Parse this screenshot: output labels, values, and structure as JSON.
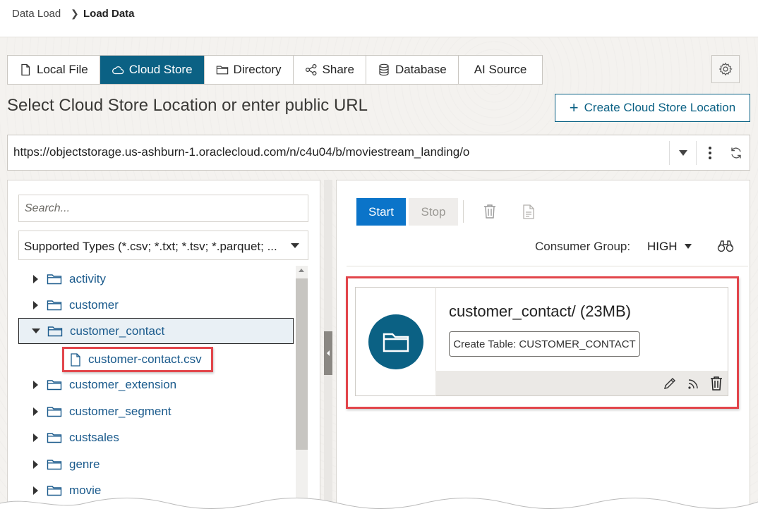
{
  "breadcrumb": {
    "parent": "Data Load",
    "current": "Load Data"
  },
  "tabs": [
    {
      "label": "Local File",
      "icon": "file-icon",
      "active": false
    },
    {
      "label": "Cloud Store",
      "icon": "cloud-icon",
      "active": true
    },
    {
      "label": "Directory",
      "icon": "folder-icon",
      "active": false
    },
    {
      "label": "Share",
      "icon": "share-icon",
      "active": false
    },
    {
      "label": "Database",
      "icon": "database-icon",
      "active": false
    },
    {
      "label": "AI Source",
      "icon": "",
      "active": false
    }
  ],
  "heading": "Select Cloud Store Location or enter public URL",
  "create_button": {
    "icon": "+",
    "label": "Create Cloud Store Location"
  },
  "url": "https://objectstorage.us-ashburn-1.oraclecloud.com/n/c4u04/b/moviestream_landing/o",
  "search": {
    "placeholder": "Search...",
    "value": ""
  },
  "filter": {
    "selected": "Supported Types (*.csv; *.txt; *.tsv; *.parquet; ..."
  },
  "tree": {
    "items": [
      {
        "label": "activity",
        "expanded": false,
        "selected": false
      },
      {
        "label": "customer",
        "expanded": false,
        "selected": false
      },
      {
        "label": "customer_contact",
        "expanded": true,
        "selected": true
      },
      {
        "label": "customer_extension",
        "expanded": false,
        "selected": false
      },
      {
        "label": "customer_segment",
        "expanded": false,
        "selected": false
      },
      {
        "label": "custsales",
        "expanded": false,
        "selected": false
      },
      {
        "label": "genre",
        "expanded": false,
        "selected": false
      },
      {
        "label": "movie",
        "expanded": false,
        "selected": false
      }
    ],
    "file": "customer-contact.csv"
  },
  "toolbar": {
    "start": "Start",
    "stop": "Stop"
  },
  "consumer_group": {
    "label": "Consumer Group:",
    "value": "HIGH"
  },
  "card": {
    "title": "customer_contact/ (23MB)",
    "tag": "Create Table: CUSTOMER_CONTACT"
  },
  "colors": {
    "accent": "#0b6184",
    "start": "#0b74c9",
    "highlight": "#e2454b",
    "link": "#1a5a8c"
  }
}
